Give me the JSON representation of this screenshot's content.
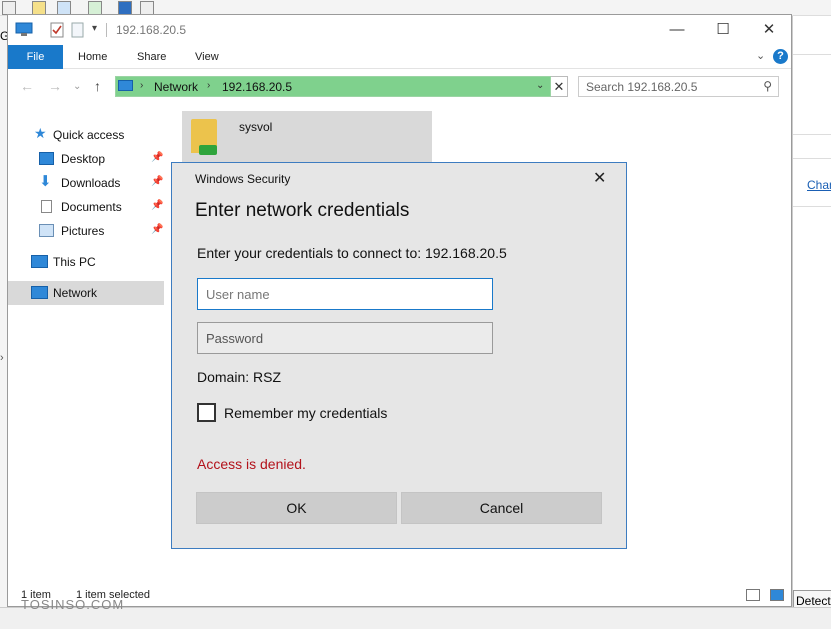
{
  "explorer": {
    "title": "192.168.20.5",
    "window_buttons": {
      "minimize": "—",
      "maximize": "☐",
      "close": "✕"
    },
    "ribbon_tabs": [
      "File",
      "Home",
      "Share",
      "View"
    ],
    "help": "?",
    "address": {
      "root": "Network",
      "current": "192.168.20.5"
    },
    "search_placeholder": "Search 192.168.20.5",
    "nav": [
      {
        "label": "Quick access",
        "icon": "star-icon"
      },
      {
        "label": "Desktop",
        "icon": "desktop-icon",
        "pinned": true
      },
      {
        "label": "Downloads",
        "icon": "download-icon",
        "pinned": true
      },
      {
        "label": "Documents",
        "icon": "document-icon",
        "pinned": true
      },
      {
        "label": "Pictures",
        "icon": "pictures-icon",
        "pinned": true
      },
      {
        "label": "This PC",
        "icon": "computer-icon"
      },
      {
        "label": "Network",
        "icon": "network-icon",
        "selected": true
      }
    ],
    "items": [
      {
        "name": "sysvol",
        "icon": "shared-folder-icon"
      }
    ],
    "status": {
      "count": "1 item",
      "selected": "1 item selected"
    }
  },
  "background": {
    "right_link": "Chan",
    "right_button": "Detect N",
    "left_letter": "G"
  },
  "watermark": "TOSINSO.COM",
  "dialog": {
    "title": "Windows Security",
    "heading": "Enter network credentials",
    "connect_text": "Enter your credentials to connect to: 192.168.20.5",
    "username_placeholder": "User name",
    "password_placeholder": "Password",
    "domain_text": "Domain: RSZ",
    "remember_label": "Remember my credentials",
    "remember_checked": false,
    "error_text": "Access is denied.",
    "ok_label": "OK",
    "cancel_label": "Cancel",
    "accent_color": "#3d7cc0",
    "error_color": "#b3121b"
  }
}
